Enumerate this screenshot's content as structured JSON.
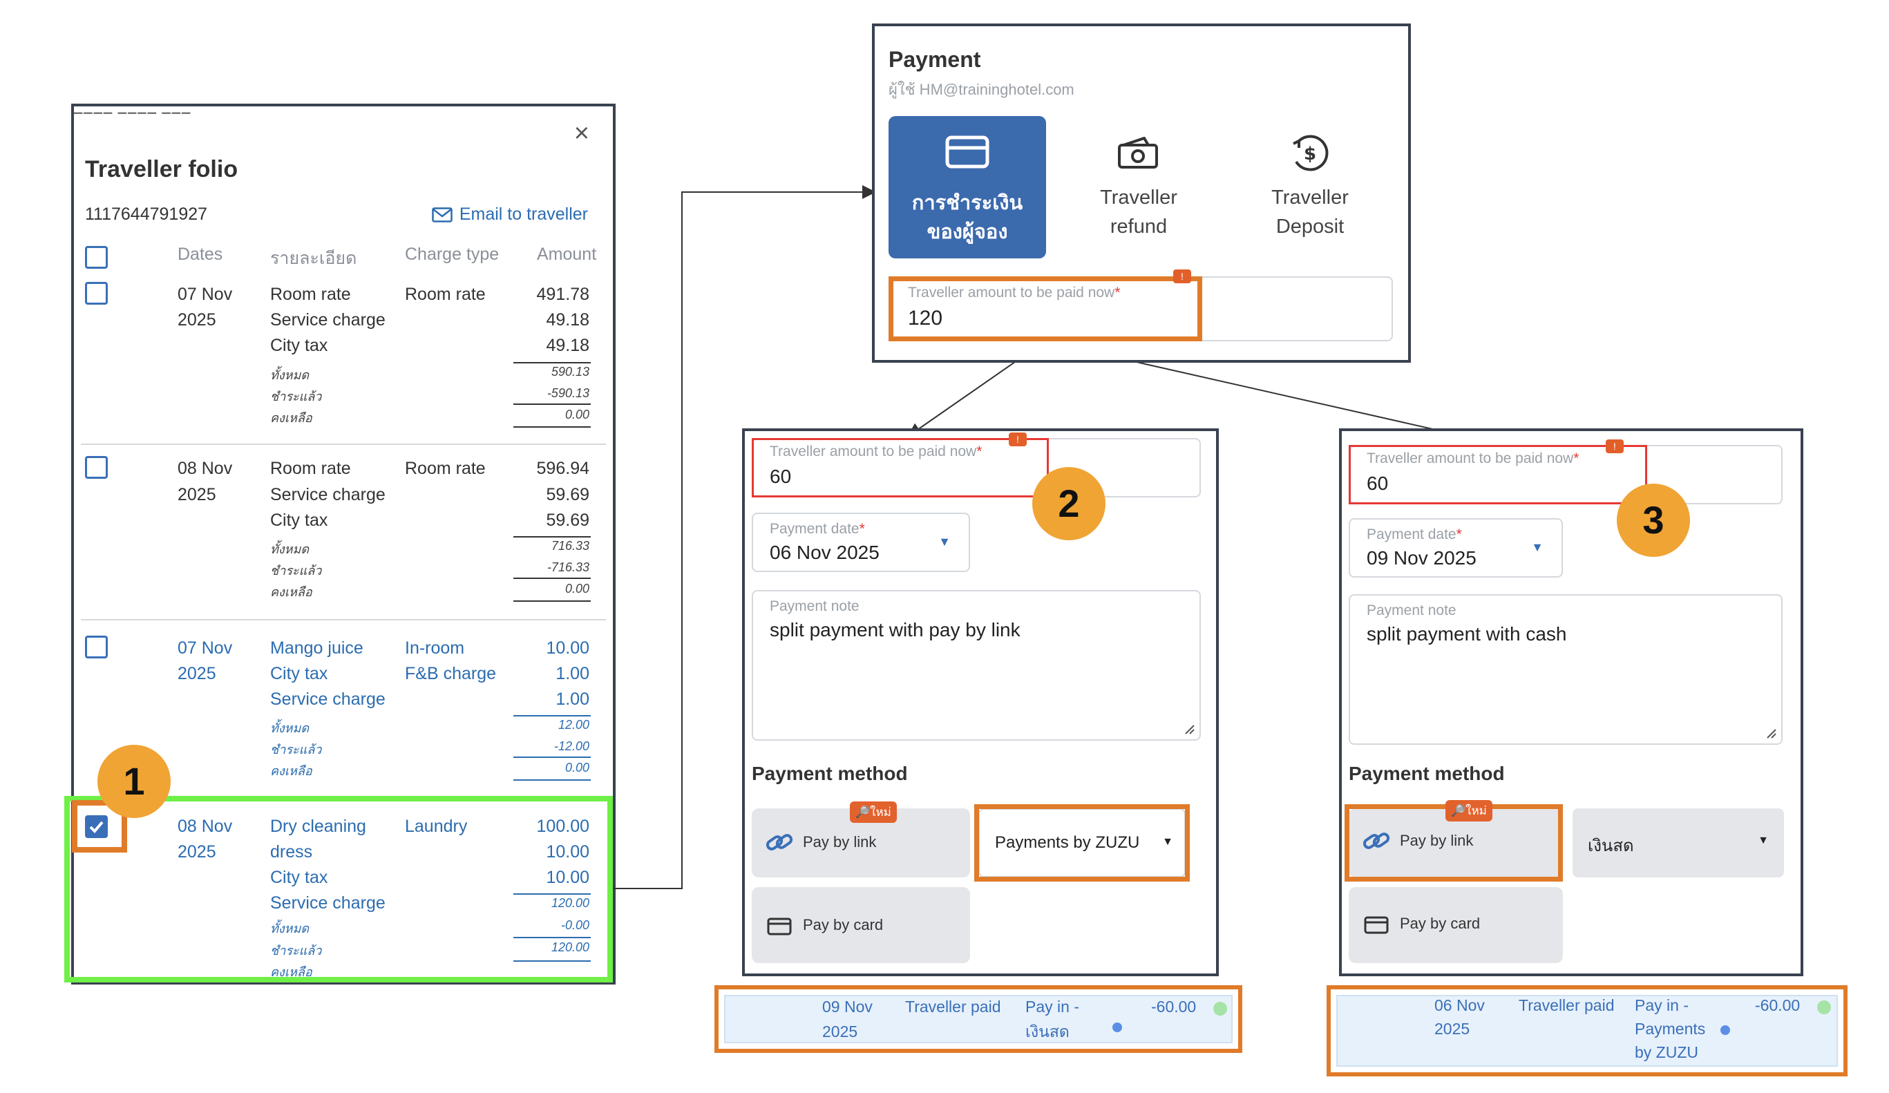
{
  "folio": {
    "title": "Traveller folio",
    "booking_number": "1117644791927",
    "email_label": "Email to traveller",
    "close_glyph": "×",
    "headers": {
      "dates": "Dates",
      "details": "รายละเอียด",
      "charge_type": "Charge type",
      "amount": "Amount"
    },
    "groups": [
      {
        "date1": "07 Nov",
        "date2": "2025",
        "lines": [
          "Room rate",
          "Service charge",
          "City tax"
        ],
        "charge_type": [
          "Room rate"
        ],
        "amounts": [
          "491.78",
          "49.18",
          "49.18"
        ],
        "summary_labels": [
          "ทั้งหมด",
          "ชำระแล้ว",
          "คงเหลือ"
        ],
        "summary_values": [
          "590.13",
          "-590.13",
          "0.00"
        ],
        "checked": false,
        "color": "#333333"
      },
      {
        "date1": "08 Nov",
        "date2": "2025",
        "lines": [
          "Room rate",
          "Service charge",
          "City tax"
        ],
        "charge_type": [
          "Room rate"
        ],
        "amounts": [
          "596.94",
          "59.69",
          "59.69"
        ],
        "summary_labels": [
          "ทั้งหมด",
          "ชำระแล้ว",
          "คงเหลือ"
        ],
        "summary_values": [
          "716.33",
          "-716.33",
          "0.00"
        ],
        "checked": false,
        "color": "#333333"
      },
      {
        "date1": "07 Nov",
        "date2": "2025",
        "lines": [
          "Mango juice",
          "City tax",
          "Service charge"
        ],
        "charge_type": [
          "In-room",
          "F&B charge"
        ],
        "amounts": [
          "10.00",
          "1.00",
          "1.00"
        ],
        "summary_labels": [
          "ทั้งหมด",
          "ชำระแล้ว",
          "คงเหลือ"
        ],
        "summary_values": [
          "12.00",
          "-12.00",
          "0.00"
        ],
        "checked": false,
        "color": "#2b6cb0"
      },
      {
        "date1": "08 Nov",
        "date2": "2025",
        "lines": [
          "Dry cleaning",
          "dress",
          "City tax",
          "Service charge"
        ],
        "charge_type": [
          "Laundry"
        ],
        "amounts": [
          "100.00",
          "10.00",
          "10.00"
        ],
        "summary_labels": [
          "ทั้งหมด",
          "ชำระแล้ว",
          "คงเหลือ"
        ],
        "summary_values": [
          "120.00",
          "-0.00",
          "120.00"
        ],
        "checked": true,
        "color": "#2b6cb0"
      }
    ]
  },
  "payment": {
    "title": "Payment",
    "user": "ผู้ใช้ HM@traininghotel.com",
    "tabs": [
      {
        "line1": "การชำระเงิน",
        "line2": "ของผู้จอง",
        "icon": "credit-card-icon",
        "active": true
      },
      {
        "line1": "Traveller",
        "line2": "refund",
        "icon": "cash-icon",
        "active": false
      },
      {
        "line1": "Traveller",
        "line2": "Deposit",
        "icon": "deposit-icon",
        "active": false
      }
    ],
    "amount_label": "Traveller amount to be paid now",
    "amount_value": "120",
    "required_mark": "*",
    "warn_glyph": "!"
  },
  "split1": {
    "badge": "2",
    "amount_label": "Traveller amount to be paid now",
    "amount_value": "60",
    "date_label": "Payment date",
    "date_value": "06 Nov 2025",
    "note_label": "Payment note",
    "note_value": "split payment with pay by link",
    "method_title": "Payment method",
    "pay_by_link": "Pay by link",
    "new_tag": "ใหม่",
    "select_value": "Payments by ZUZU",
    "pay_by_card": "Pay by card",
    "dropdown_glyph": "▼"
  },
  "split2": {
    "badge": "3",
    "amount_label": "Traveller amount to be paid now",
    "amount_value": "60",
    "date_label": "Payment date",
    "date_value": "09 Nov 2025",
    "note_label": "Payment note",
    "note_value": "split payment with cash",
    "method_title": "Payment method",
    "pay_by_link": "Pay by link",
    "new_tag": "ใหม่",
    "select_value": "เงินสด",
    "pay_by_card": "Pay by card",
    "dropdown_glyph": "▼"
  },
  "badge1": "1",
  "strip1": {
    "date1": "09 Nov",
    "date2": "2025",
    "type": "Traveller paid",
    "method1": "Pay in -",
    "method2": "เงินสด",
    "amount": "-60.00"
  },
  "strip2": {
    "date1": "06 Nov",
    "date2": "2025",
    "type": "Traveller paid",
    "method1": "Pay in -",
    "method2": "Payments",
    "method3": "by ZUZU",
    "amount": "-60.00"
  },
  "colors": {
    "accent": "#3a6fb8",
    "highlight_orange": "#e07b29",
    "highlight_green": "#6ef046",
    "badge": "#f0a434",
    "warning": "#e53935"
  }
}
